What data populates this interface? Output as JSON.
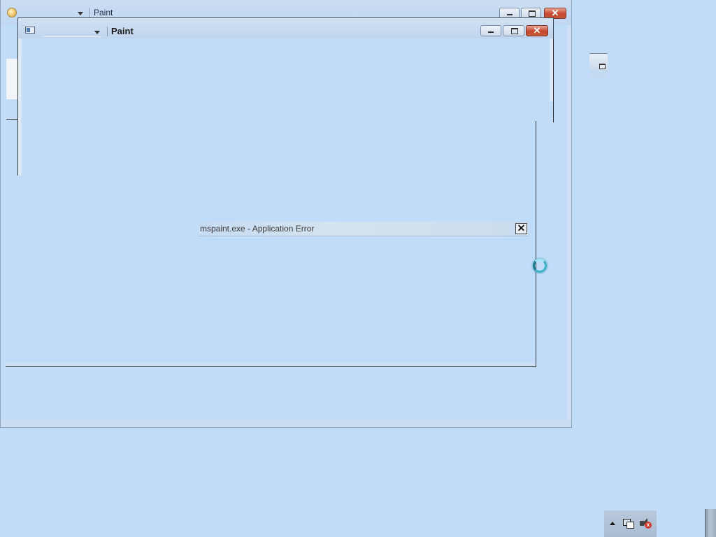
{
  "outer_window": {
    "title": "Paint",
    "controls": {
      "minimize": "minimize",
      "maximize": "maximize",
      "close": "close"
    },
    "icon": "paint-app-icon"
  },
  "inner_window": {
    "title": "Paint",
    "icon": "system-menu-icon",
    "controls": {
      "minimize": "minimize",
      "maximize": "maximize",
      "close": "close"
    }
  },
  "error_dialog": {
    "title": "mspaint.exe - Application Error",
    "close_glyph": "✕"
  },
  "cursor": {
    "state": "busy",
    "icon": "busy-spinner-icon"
  },
  "tray": {
    "icons": [
      "show-hidden-icons-chevron",
      "network-icon",
      "volume-muted-icon"
    ],
    "volume_muted_glyph": "x"
  },
  "colors": {
    "desktop": "#c1dcf9",
    "close_button": "#c7472e",
    "busy_cursor": "#3fb4c9"
  }
}
